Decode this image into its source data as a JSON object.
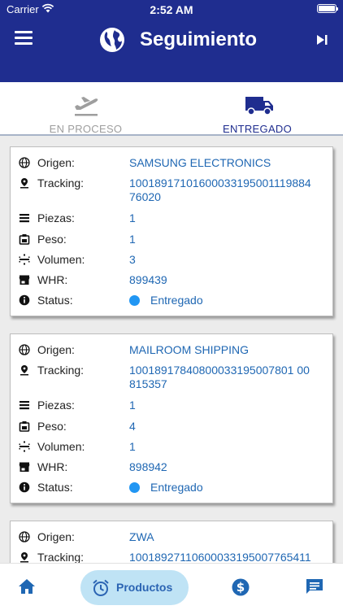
{
  "status_bar": {
    "carrier": "Carrier",
    "time": "2:52 AM"
  },
  "header": {
    "title": "Seguimiento",
    "menu_icon": "hamburger-menu-icon",
    "logo_icon": "globe-icon",
    "action_icon": "skip-next-icon"
  },
  "tabs": [
    {
      "label": "EN PROCESO",
      "icon": "airplane-departure-icon",
      "active": false
    },
    {
      "label": "ENTREGADO",
      "icon": "truck-icon",
      "active": true
    }
  ],
  "field_labels": {
    "origen": "Origen:",
    "tracking": "Tracking:",
    "piezas": "Piezas:",
    "peso": "Peso:",
    "volumen": "Volumen:",
    "whr": "WHR:",
    "status": "Status:"
  },
  "shipments": [
    {
      "origen": "SAMSUNG ELECTRONICS",
      "tracking": "100189171016000331950011198847 6020",
      "tracking_lines": [
        "100189171016000331950011198847",
        "6020"
      ],
      "piezas": "1",
      "peso": "1",
      "volumen": "3",
      "whr": "899439",
      "status": "Entregado"
    },
    {
      "origen": "MAILROOM SHIPPING",
      "tracking_lines": [
        "100189178408000331950078010",
        "0815357"
      ],
      "piezas": "1",
      "peso": "4",
      "volumen": "1",
      "whr": "898942",
      "status": "Entregado"
    },
    {
      "origen": "ZWA",
      "tracking_lines": [
        "100189271106000331950077654 11"
      ],
      "piezas": "",
      "peso": "",
      "volumen": "",
      "whr": "",
      "status": ""
    }
  ],
  "tracking_display": [
    "10018917101600033195001119884\n76020",
    "10018917840800033195007801 00\n815357",
    "10018927110600033195007765411"
  ],
  "bottom_nav": {
    "productos_label": "Productos",
    "home_icon": "home-icon",
    "productos_icon": "alarm-clock-icon",
    "dollar_icon": "dollar-icon",
    "chat_icon": "chat-icon"
  },
  "colors": {
    "primary": "#1f2d8f",
    "link": "#1f67b3",
    "status_dot": "#2196f3",
    "active_nav_bg": "#bfe3f5"
  }
}
